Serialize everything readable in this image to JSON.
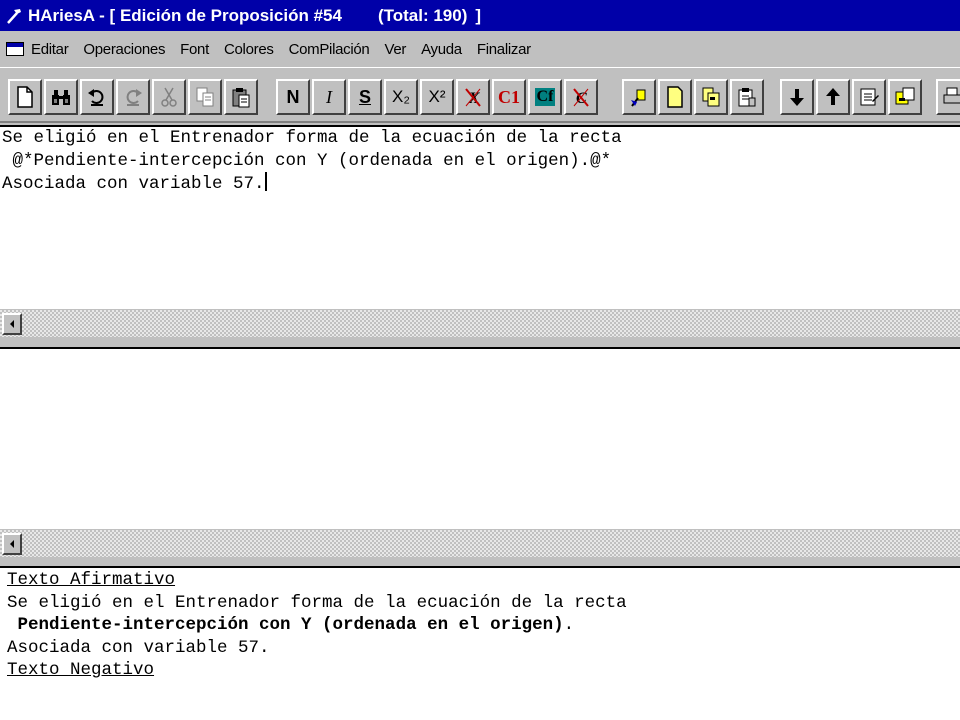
{
  "window": {
    "title": "HAriesA - [ Edición de Proposición #54",
    "total": "(Total: 190)",
    "close_bracket": "]"
  },
  "menu": {
    "items": [
      {
        "label": "Editar"
      },
      {
        "label": "Operaciones"
      },
      {
        "label": "Font"
      },
      {
        "label": "Colores"
      },
      {
        "label": "ComPilación"
      },
      {
        "label": "Ver"
      },
      {
        "label": "Ayuda"
      },
      {
        "label": "Finalizar"
      }
    ]
  },
  "toolbar": {
    "format": {
      "bold": "N",
      "italic": "I",
      "underline": "S",
      "subscript": "X₂",
      "superscript": "X²",
      "color1": "C1",
      "color_f": "Cf"
    },
    "icons": [
      "new-document-icon",
      "find-icon",
      "undo-icon",
      "redo-icon",
      "cut-icon",
      "copy-icon",
      "paste-icon",
      "bold-icon",
      "italic-icon",
      "underline-icon",
      "subscript-icon",
      "superscript-icon",
      "clear-format-icon",
      "color1-icon",
      "colorf-icon",
      "clear-color-icon",
      "insert-icon",
      "blank-page-icon",
      "duplicate-icon",
      "properties-icon",
      "move-down-icon",
      "move-up-icon",
      "list-edit-icon",
      "export-icon",
      "print-icon"
    ]
  },
  "editor": {
    "lines": [
      "Se eligió en el Entrenador forma de la ecuación de la recta",
      " @*Pendiente-intercepción con Y (ordenada en el origen).@*",
      "Asociada con variable 57."
    ]
  },
  "preview": {
    "heading_affirmative": "Texto Afirmativo",
    "line1": "Se eligió en el Entrenador forma de la ecuación de la recta",
    "bold_line": " Pendiente-intercepción con Y (ordenada en el origen)",
    "bold_line_tail": ".",
    "line3": "Asociada con variable 57.",
    "heading_negative": "Texto Negativo"
  }
}
